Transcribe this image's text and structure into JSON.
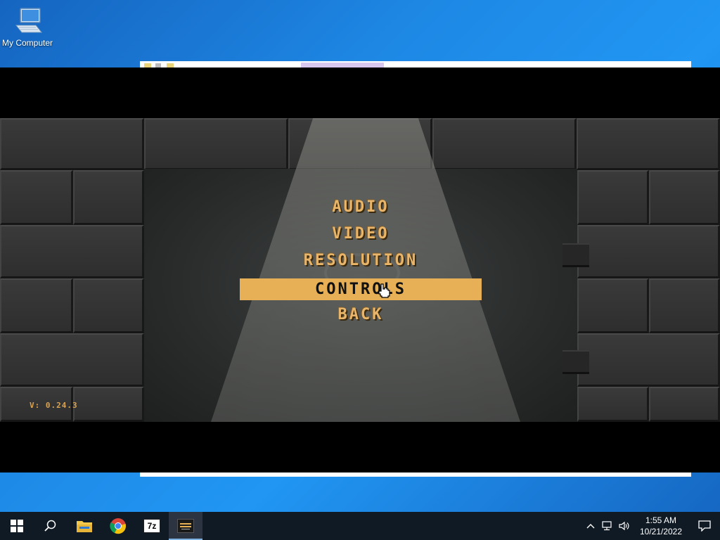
{
  "desktop": {
    "icons": [
      {
        "label": "My Computer",
        "icon": "computer-icon"
      }
    ]
  },
  "game": {
    "menu": {
      "items": [
        {
          "label": "AUDIO",
          "selected": false
        },
        {
          "label": "VIDEO",
          "selected": false
        },
        {
          "label": "RESOLUTION",
          "selected": false
        },
        {
          "label": "CONTROLS",
          "selected": true
        },
        {
          "label": "BACK",
          "selected": false
        }
      ]
    },
    "version": "V: 0.24.3",
    "colors": {
      "menu_text": "#e8b56a",
      "highlight": "#e8b056",
      "letterbox": "#000000"
    }
  },
  "taskbar": {
    "buttons": [
      {
        "name": "start",
        "icon": "windows-start-icon"
      },
      {
        "name": "search",
        "icon": "search-icon"
      },
      {
        "name": "file-explorer",
        "icon": "folder-icon"
      },
      {
        "name": "chrome",
        "icon": "chrome-icon"
      },
      {
        "name": "7zip",
        "icon": "7zip-icon",
        "text": "7z"
      },
      {
        "name": "game",
        "icon": "game-app-icon",
        "active": true
      }
    ],
    "tray": {
      "icons": [
        "chevron-up-icon",
        "network-icon",
        "volume-icon"
      ],
      "time": "1:55 AM",
      "date": "10/21/2022",
      "notification_icon": "notification-icon"
    }
  }
}
